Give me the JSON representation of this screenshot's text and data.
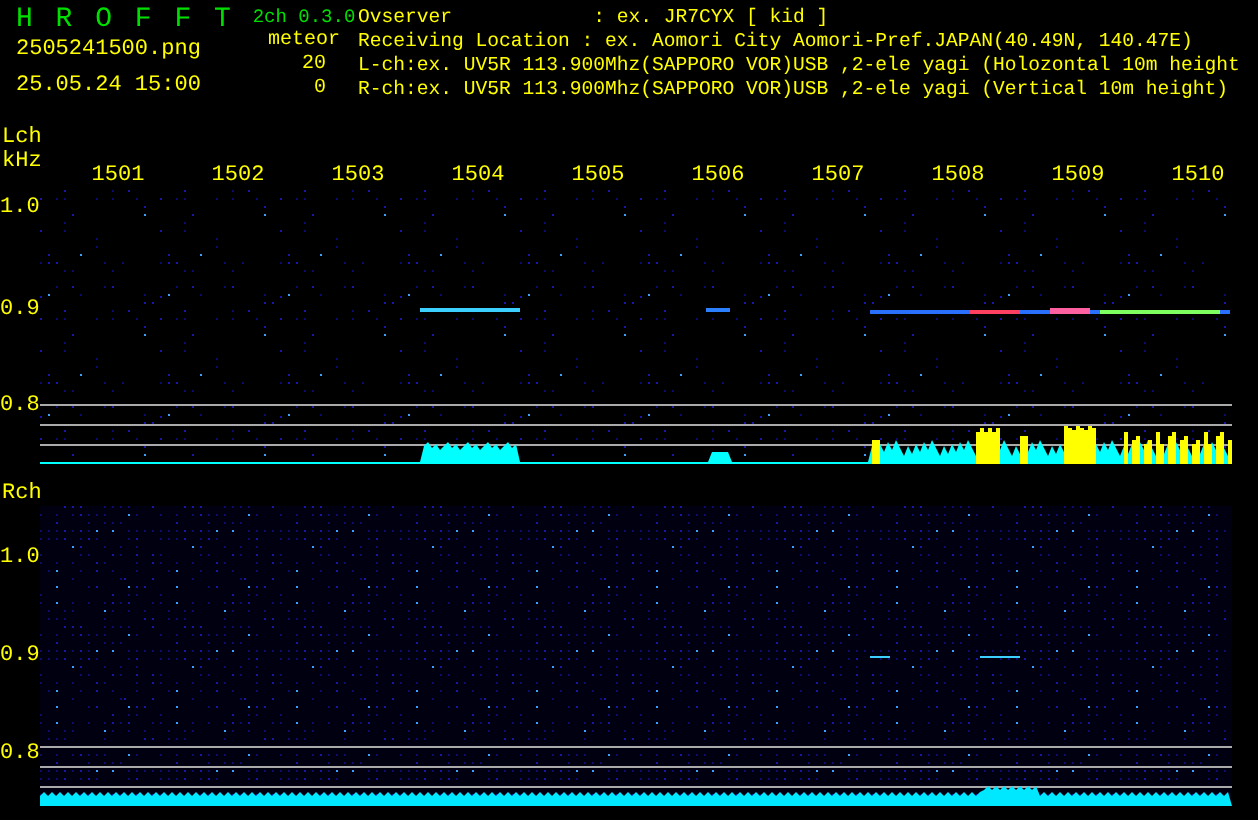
{
  "header": {
    "app_title": "H R O F F T",
    "version": "2ch 0.3.0",
    "filename": "2505241500.png",
    "datetime": "25.05.24 15:00",
    "meteor_label": "meteor",
    "lch_count": "20",
    "rch_count": "0",
    "info_lines": [
      "Ovserver            : ex. JR7CYX [ kid ]",
      "Receiving Location : ex. Aomori City Aomori-Pref.JAPAN(40.49N, 140.47E)",
      "L-ch:ex. UV5R 113.900Mhz(SAPPORO VOR)USB ,2-ele yagi (Holozontal 10m height",
      "R-ch:ex. UV5R 113.900Mhz(SAPPORO VOR)USB ,2-ele yagi (Vertical 10m height)"
    ]
  },
  "left_channel": {
    "label": "Lch",
    "unit": "kHz",
    "time_labels": [
      "1501",
      "1502",
      "1503",
      "1504",
      "1505",
      "1506",
      "1507",
      "1508",
      "1509",
      "1510"
    ],
    "y_labels": [
      "1.0",
      "0.9",
      "0.8"
    ]
  },
  "right_channel": {
    "label": "Rch",
    "y_labels": [
      "1.0",
      "0.9",
      "0.8"
    ]
  }
}
